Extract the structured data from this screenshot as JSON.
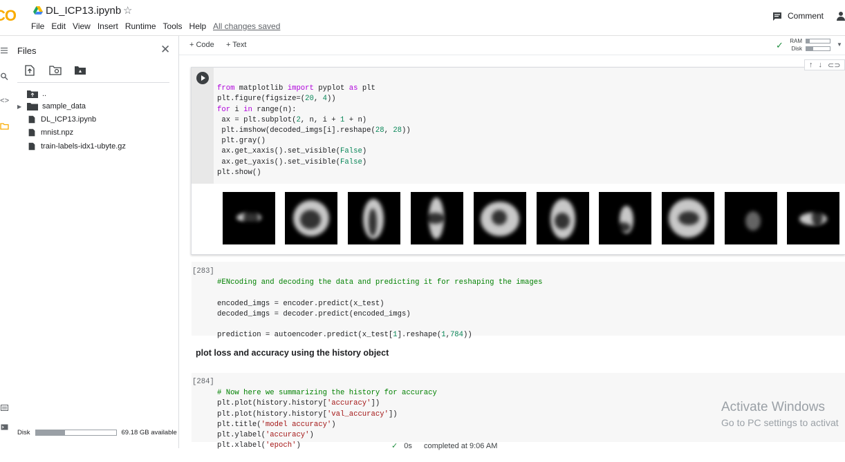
{
  "header": {
    "logo": "CO",
    "doc_title": "DL_ICP13.ipynb",
    "star": "☆",
    "menu": [
      "File",
      "Edit",
      "View",
      "Insert",
      "Runtime",
      "Tools",
      "Help"
    ],
    "saved_status": "All changes saved",
    "comment_label": "Comment"
  },
  "files_panel": {
    "title": "Files",
    "tree": [
      {
        "name": "..",
        "type": "parent"
      },
      {
        "name": "sample_data",
        "type": "folder"
      },
      {
        "name": "DL_ICP13.ipynb",
        "type": "file"
      },
      {
        "name": "mnist.npz",
        "type": "file"
      },
      {
        "name": "train-labels-idx1-ubyte.gz",
        "type": "file"
      }
    ],
    "disk_label": "Disk",
    "disk_available": "69.18 GB available",
    "disk_used_fraction": 0.36
  },
  "toolbar": {
    "add_code": "+ Code",
    "add_text": "+ Text",
    "ram_label": "RAM",
    "disk_label": "Disk",
    "ram_used_fraction": 0.15,
    "disk_used_fraction": 0.3
  },
  "cells": {
    "cell1_lines": [
      "from matplotlib import pyplot as plt",
      "plt.figure(figsize=(20, 4))",
      "for i in range(n):",
      " ax = plt.subplot(2, n, i + 1 + n)",
      " plt.imshow(decoded_imgs[i].reshape(28, 28))",
      " plt.gray()",
      " ax.get_xaxis().set_visible(False)",
      " ax.get_yaxis().set_visible(False)",
      "plt.show()"
    ],
    "cell2_prompt": "[283]",
    "cell2_lines": [
      "#ENcoding and decoding the data and predicting it for reshaping the images",
      "",
      "encoded_imgs = encoder.predict(x_test)",
      "decoded_imgs = decoder.predict(encoded_imgs)",
      "",
      "prediction = autoencoder.predict(x_test[1].reshape(1,784))"
    ],
    "text_heading": "plot loss and accuracy using the history object",
    "cell3_prompt": "[284]",
    "cell3_lines": [
      "# Now here we summarizing the history for accuracy",
      "plt.plot(history.history['accuracy'])",
      "plt.plot(history.history['val_accuracy'])",
      "plt.title('model accuracy')",
      "plt.ylabel('accuracy')",
      "plt.xlabel('epoch')"
    ]
  },
  "status_bar": {
    "check": "✓",
    "duration": "0s",
    "completed": "completed at 9:06 AM"
  },
  "watermark": {
    "line1": "Activate Windows",
    "line2": "Go to PC settings to activat"
  },
  "colors": {
    "keyword": "#af00db",
    "number": "#098658",
    "string": "#a31515",
    "comment": "#008000",
    "logo": "#f9ab00"
  }
}
